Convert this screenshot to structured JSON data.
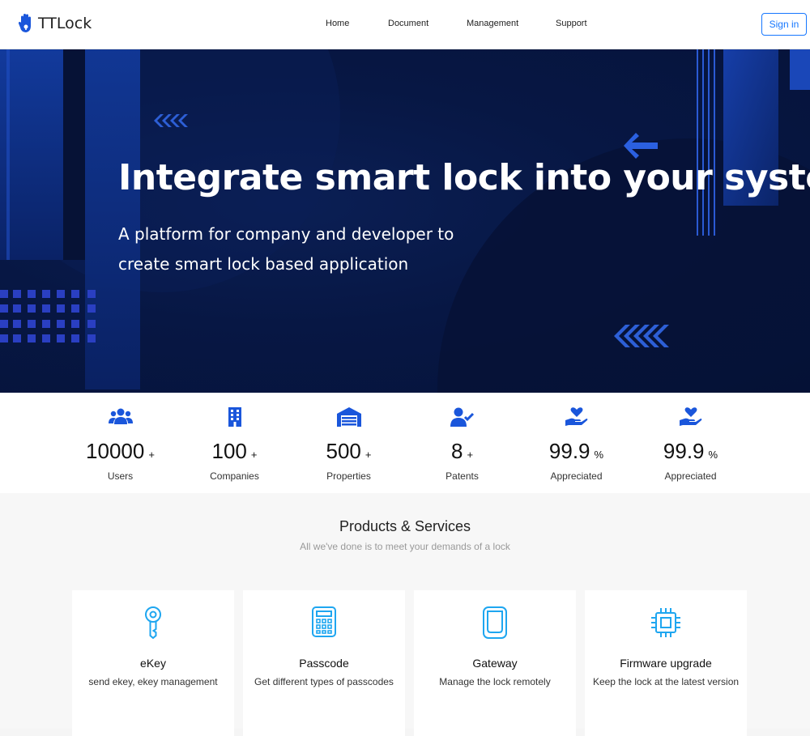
{
  "header": {
    "logo_text": "TTLock",
    "logo_icon": "hand-icon",
    "nav": [
      {
        "label": "Home"
      },
      {
        "label": "Document"
      },
      {
        "label": "Management"
      },
      {
        "label": "Support"
      }
    ],
    "signin_label": "Sign in"
  },
  "hero": {
    "title": "Integrate smart lock into your system",
    "subtitle_line1": "A platform for company and developer to",
    "subtitle_line2": "create smart lock based application"
  },
  "stats": [
    {
      "icon": "users-icon",
      "value": "10000",
      "suffix": "+",
      "label": "Users"
    },
    {
      "icon": "building-icon",
      "value": "100",
      "suffix": "+",
      "label": "Companies"
    },
    {
      "icon": "warehouse-icon",
      "value": "500",
      "suffix": "+",
      "label": "Properties"
    },
    {
      "icon": "user-check-icon",
      "value": "8",
      "suffix": "+",
      "label": "Patents"
    },
    {
      "icon": "hand-heart-icon",
      "value": "99.9",
      "suffix": "%",
      "label": "Appreciated"
    },
    {
      "icon": "hand-heart-icon",
      "value": "99.9",
      "suffix": "%",
      "label": "Appreciated"
    }
  ],
  "products": {
    "title": "Products & Services",
    "subtitle": "All we've done is to meet your demands of a lock",
    "cards": [
      {
        "icon": "key-icon",
        "title": "eKey",
        "desc": "send ekey, ekey management"
      },
      {
        "icon": "keypad-icon",
        "title": "Passcode",
        "desc": "Get different types of passcodes"
      },
      {
        "icon": "gateway-icon",
        "title": "Gateway",
        "desc": "Manage the lock remotely"
      },
      {
        "icon": "chip-icon",
        "title": "Firmware upgrade",
        "desc": "Keep the lock at the latest version"
      }
    ]
  },
  "colors": {
    "accent": "#1677ff",
    "icon_blue": "#1a56db",
    "card_icon": "#1ea6f0",
    "hero_bg": "#071744"
  }
}
